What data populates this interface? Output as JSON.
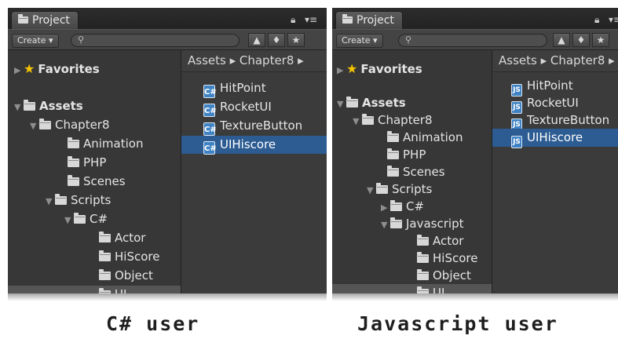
{
  "left": {
    "tab": "Project",
    "create": "Create ▾",
    "breadcrumb": "Assets ▸ Chapter8 ▸",
    "tree": [
      {
        "label": "Favorites",
        "tri": "▶",
        "star": true,
        "bold": true
      },
      {
        "label": "Assets",
        "tri": "▼",
        "bold": true
      },
      {
        "label": "Chapter8",
        "tri": "▼"
      },
      {
        "label": "Animation",
        "tri": ""
      },
      {
        "label": "PHP",
        "tri": ""
      },
      {
        "label": "Scenes",
        "tri": ""
      },
      {
        "label": "Scripts",
        "tri": "▼"
      },
      {
        "label": "C#",
        "tri": "▼"
      },
      {
        "label": "Actor",
        "tri": ""
      },
      {
        "label": "HiScore",
        "tri": ""
      },
      {
        "label": "Object",
        "tri": ""
      },
      {
        "label": "UI",
        "tri": ""
      }
    ],
    "files": [
      "HitPoint",
      "RocketUI",
      "TextureButton",
      "UIHiscore"
    ],
    "file_icon": "C#"
  },
  "right": {
    "tab": "Project",
    "create": "Create ▾",
    "breadcrumb": "Assets ▸ Chapter8 ▸",
    "tree": [
      {
        "label": "Favorites",
        "tri": "▶",
        "star": true,
        "bold": true
      },
      {
        "label": "Assets",
        "tri": "▼",
        "bold": true
      },
      {
        "label": "Chapter8",
        "tri": "▼"
      },
      {
        "label": "Animation",
        "tri": ""
      },
      {
        "label": "PHP",
        "tri": ""
      },
      {
        "label": "Scenes",
        "tri": ""
      },
      {
        "label": "Scripts",
        "tri": "▼"
      },
      {
        "label": "C#",
        "tri": "▶"
      },
      {
        "label": "Javascript",
        "tri": "▼"
      },
      {
        "label": "Actor",
        "tri": ""
      },
      {
        "label": "HiScore",
        "tri": ""
      },
      {
        "label": "Object",
        "tri": ""
      },
      {
        "label": "UI",
        "tri": ""
      }
    ],
    "files": [
      "HitPoint",
      "RocketUI",
      "TextureButton",
      "UIHiscore"
    ],
    "file_icon": "JS"
  },
  "captions": {
    "csharp": "C# user",
    "javascript": "Javascript user"
  },
  "colors": {
    "panel": "#3a3a3a",
    "selection_blue": "#2c5c92",
    "selection_gray": "#555555",
    "star": "#f4c400"
  },
  "icons": [
    "folder-icon",
    "star-icon",
    "lock-icon",
    "menu-icon",
    "search-icon",
    "label-icon",
    "csharp-script-icon",
    "javascript-script-icon"
  ]
}
